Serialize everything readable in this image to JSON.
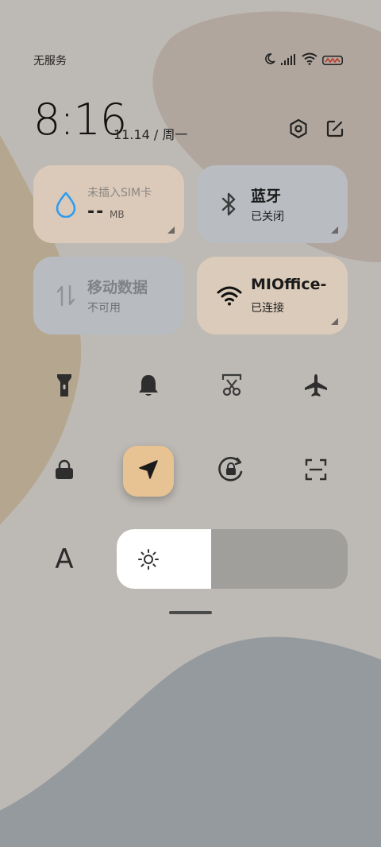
{
  "status_bar": {
    "carrier": "无服务",
    "icons": [
      "moon-icon",
      "signal-icon",
      "wifi-icon",
      "battery-icon"
    ]
  },
  "header": {
    "time": "8:16",
    "date": "11.14 / 周一",
    "icons": [
      "settings-icon",
      "edit-icon"
    ]
  },
  "tiles": {
    "sim": {
      "label": "未插入SIM卡",
      "value": "--",
      "unit": "MB",
      "icon": "water-drop-icon"
    },
    "bluetooth": {
      "title": "蓝牙",
      "status": "已关闭",
      "icon": "bluetooth-icon"
    },
    "mobile_data": {
      "title": "移动数据",
      "status": "不可用",
      "icon": "data-arrows-icon"
    },
    "wifi": {
      "title": "MIOffice-",
      "status": "已连接",
      "icon": "wifi-icon"
    }
  },
  "toggles": [
    {
      "name": "flashlight",
      "icon": "flashlight-icon"
    },
    {
      "name": "ringer",
      "icon": "bell-icon"
    },
    {
      "name": "screenshot",
      "icon": "scissors-icon"
    },
    {
      "name": "airplane-mode",
      "icon": "airplane-icon"
    },
    {
      "name": "lock-screen",
      "icon": "lock-icon"
    },
    {
      "name": "location",
      "icon": "location-arrow-icon",
      "active": true
    },
    {
      "name": "rotation-lock",
      "icon": "rotation-lock-icon"
    },
    {
      "name": "scanner",
      "icon": "scan-icon"
    }
  ],
  "brightness": {
    "font_label": "A",
    "level": 0.41,
    "icon": "sun-icon"
  },
  "colors": {
    "background": "#bdb9b4",
    "accent_location": "#e7c293",
    "tile_warm": "#dbcab9",
    "tile_cool": "#b9bdc2",
    "sim_drop": "#2f9cf0"
  }
}
